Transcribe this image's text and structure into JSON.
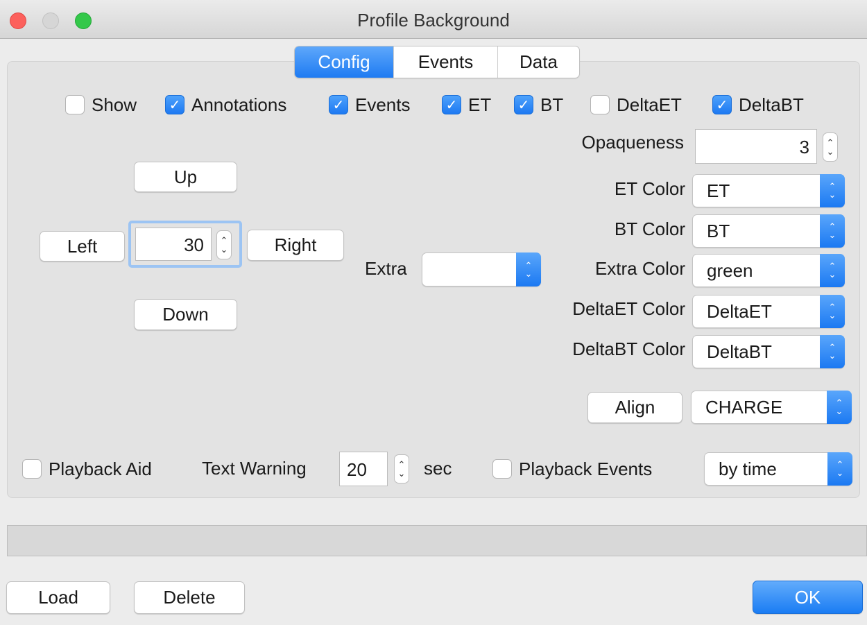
{
  "window": {
    "title": "Profile Background"
  },
  "tabs": [
    {
      "label": "Config",
      "active": true
    },
    {
      "label": "Events",
      "active": false
    },
    {
      "label": "Data",
      "active": false
    }
  ],
  "show_options": {
    "show": {
      "label": "Show",
      "checked": false
    },
    "annotations": {
      "label": "Annotations",
      "checked": true
    },
    "events": {
      "label": "Events",
      "checked": true
    },
    "et": {
      "label": "ET",
      "checked": true
    },
    "bt": {
      "label": "BT",
      "checked": true
    },
    "delta_et": {
      "label": "DeltaET",
      "checked": false
    },
    "delta_bt": {
      "label": "DeltaBT",
      "checked": true
    }
  },
  "move": {
    "up_label": "Up",
    "down_label": "Down",
    "left_label": "Left",
    "right_label": "Right",
    "step_value": "30"
  },
  "extra": {
    "label": "Extra",
    "value": ""
  },
  "opaqueness": {
    "label": "Opaqueness",
    "value": "3"
  },
  "colors": {
    "et": {
      "label": "ET Color",
      "value": "ET"
    },
    "bt": {
      "label": "BT Color",
      "value": "BT"
    },
    "extra": {
      "label": "Extra Color",
      "value": "green"
    },
    "delta_et": {
      "label": "DeltaET Color",
      "value": "DeltaET"
    },
    "delta_bt": {
      "label": "DeltaBT Color",
      "value": "DeltaBT"
    }
  },
  "align": {
    "button_label": "Align",
    "value": "CHARGE"
  },
  "playback": {
    "aid_label": "Playback Aid",
    "aid_checked": false,
    "text_warning_label": "Text Warning",
    "text_warning_value": "20",
    "sec_label": "sec",
    "events_label": "Playback Events",
    "events_checked": false,
    "mode_value": "by time"
  },
  "footer": {
    "load_label": "Load",
    "delete_label": "Delete",
    "ok_label": "OK"
  },
  "colors_theme": {
    "accent": "#1e7bf2",
    "close": "#fc605c",
    "maximize": "#34c84a"
  }
}
